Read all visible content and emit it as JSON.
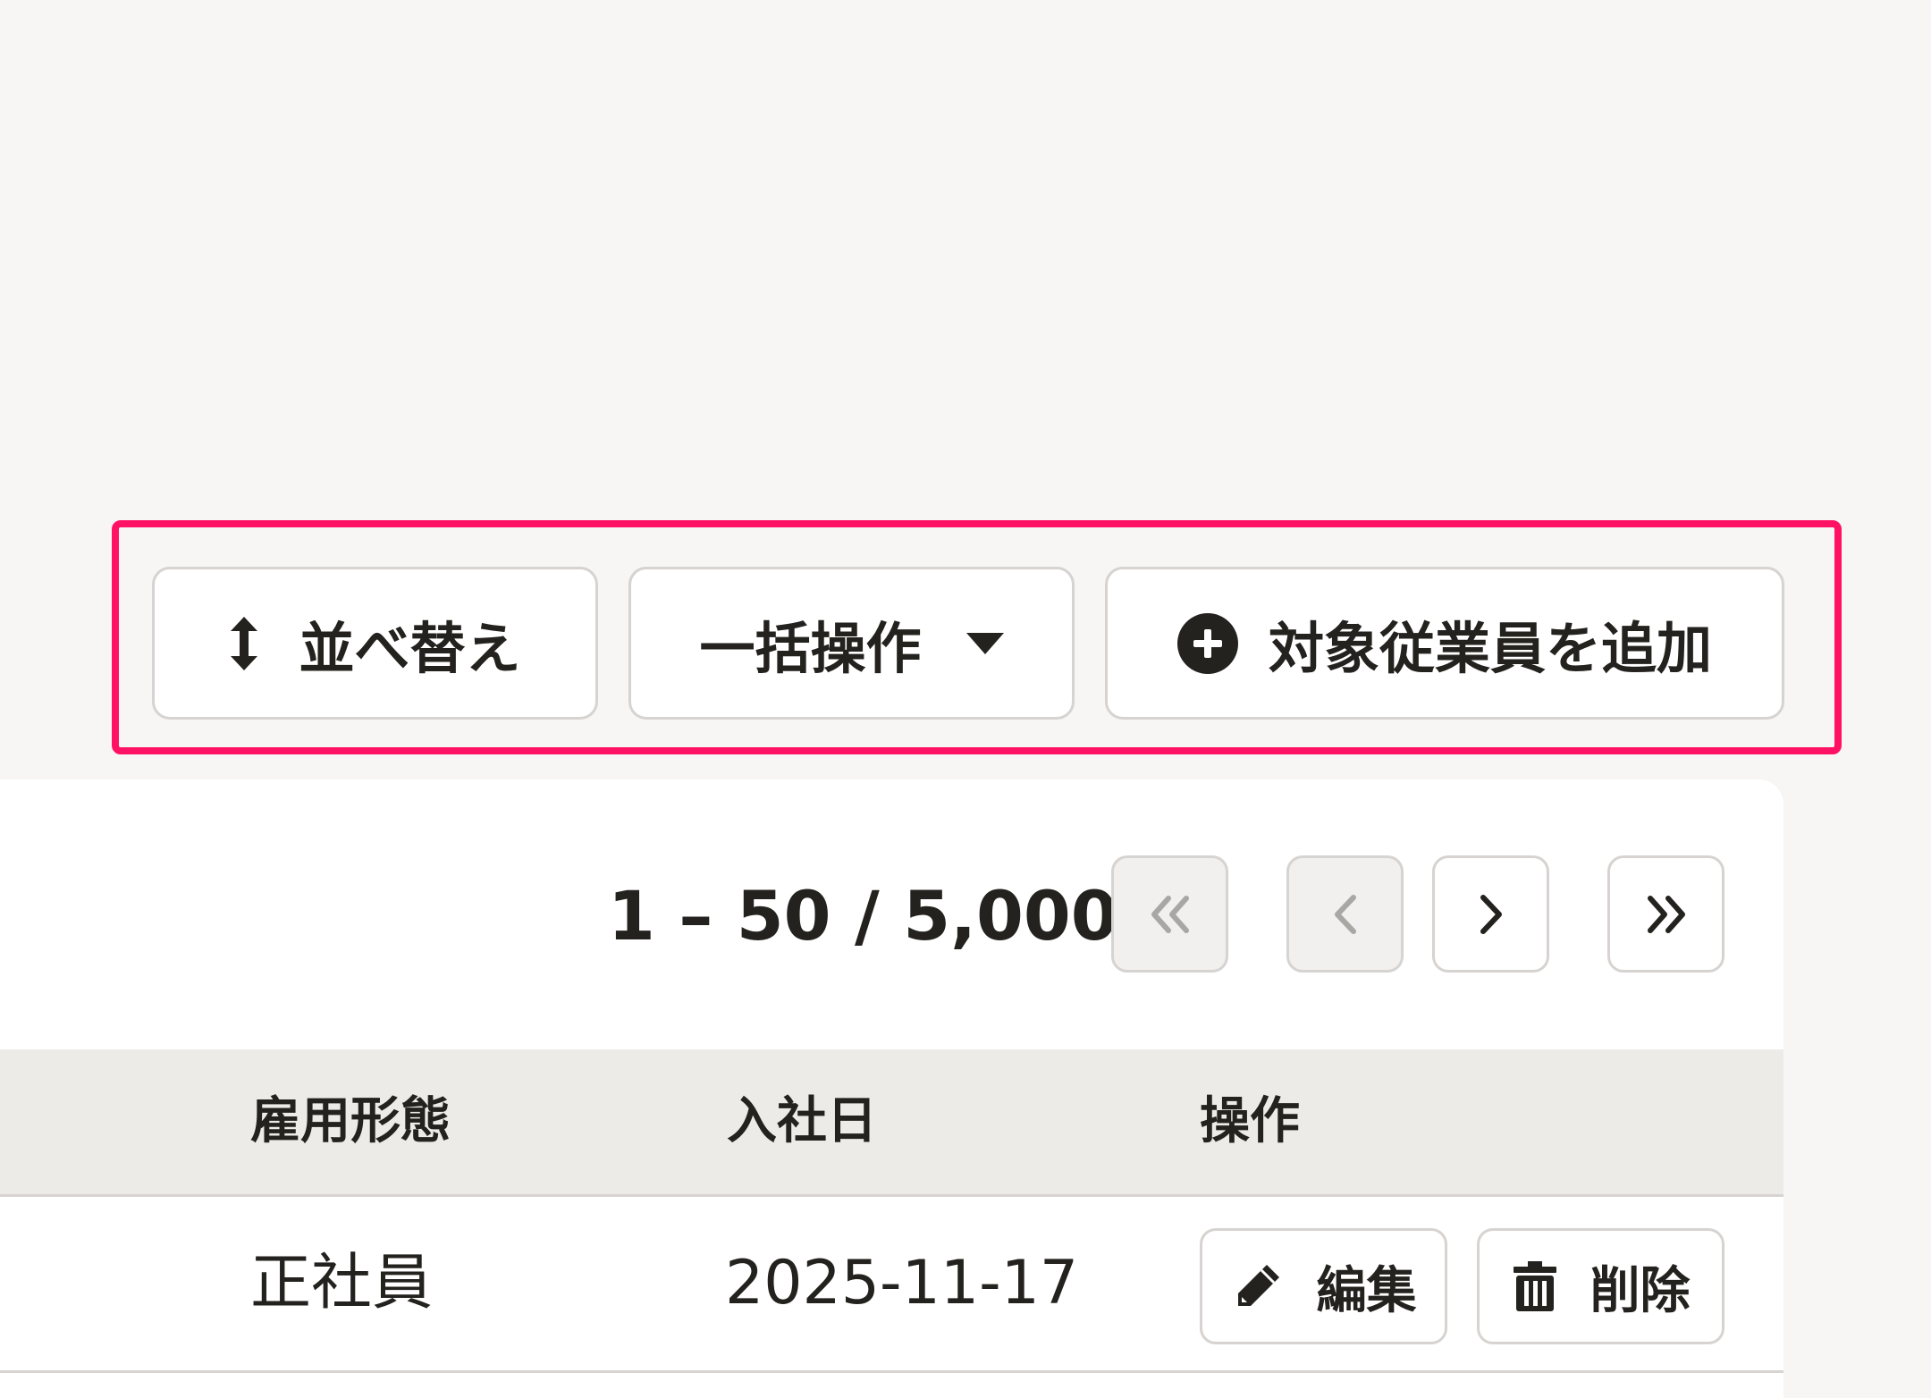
{
  "toolbar": {
    "sort_label": "並べ替え",
    "bulk_label": "一括操作",
    "add_label": "対象従業員を追加"
  },
  "pagination": {
    "range_text": "1 – 50 / 5,000",
    "first_disabled": true,
    "prev_disabled": true
  },
  "table": {
    "columns": [
      "雇用形態",
      "入社日",
      "操作"
    ],
    "rows": [
      {
        "employment_type": "正社員",
        "hire_date": "2025-11-17",
        "edit_label": "編集",
        "delete_label": "削除"
      }
    ]
  },
  "colors": {
    "highlight": "#ff1263",
    "text": "#23221e",
    "border": "#d6d3d0",
    "header_bg": "#edebe8",
    "page_bg": "#f7f6f5"
  }
}
